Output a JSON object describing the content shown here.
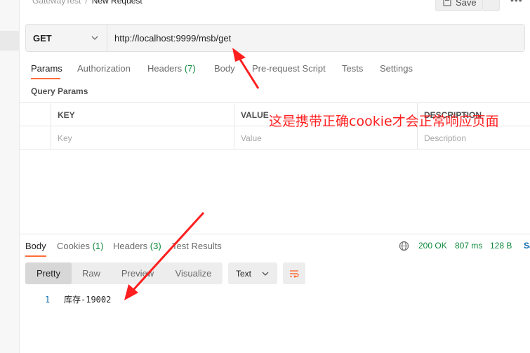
{
  "breadcrumb": {
    "parent": "GatewayTest",
    "separator": "/",
    "current": "New Request"
  },
  "toolbar": {
    "save_label": "Save",
    "save_icon": "save-icon",
    "more_icon": "more-icon"
  },
  "request": {
    "method": "GET",
    "url": "http://localhost:9999/msb/get"
  },
  "request_tabs": [
    {
      "label": "Params",
      "count": "",
      "active": true
    },
    {
      "label": "Authorization",
      "count": "",
      "active": false
    },
    {
      "label": "Headers",
      "count": "(7)",
      "active": false
    },
    {
      "label": "Body",
      "count": "",
      "active": false
    },
    {
      "label": "Pre-request Script",
      "count": "",
      "active": false
    },
    {
      "label": "Tests",
      "count": "",
      "active": false
    },
    {
      "label": "Settings",
      "count": "",
      "active": false
    }
  ],
  "query_params": {
    "title": "Query Params",
    "columns": [
      "KEY",
      "VALUE",
      "DESCRIPTION"
    ],
    "placeholders": {
      "key": "Key",
      "value": "Value",
      "description": "Description"
    }
  },
  "annotation": "这是携带正确cookie才会正常响应页面",
  "response_tabs": [
    {
      "label": "Body",
      "count": "",
      "active": true
    },
    {
      "label": "Cookies",
      "count": "(1)",
      "active": false
    },
    {
      "label": "Headers",
      "count": "(3)",
      "active": false
    },
    {
      "label": "Test Results",
      "count": "",
      "active": false
    }
  ],
  "response_status": {
    "status": "200 OK",
    "time": "807 ms",
    "size": "128 B",
    "save_label": "Sa",
    "status_color": "#0e8a3c"
  },
  "body_formats": {
    "options": [
      "Pretty",
      "Raw",
      "Preview",
      "Visualize"
    ],
    "selected": "Pretty"
  },
  "body_language": "Text",
  "response_body": {
    "line_number": "1",
    "text": "库存-19002"
  },
  "colors": {
    "accent": "#ff6c37",
    "annotation": "#ff1f1f",
    "link_blue": "#0b6aae"
  }
}
